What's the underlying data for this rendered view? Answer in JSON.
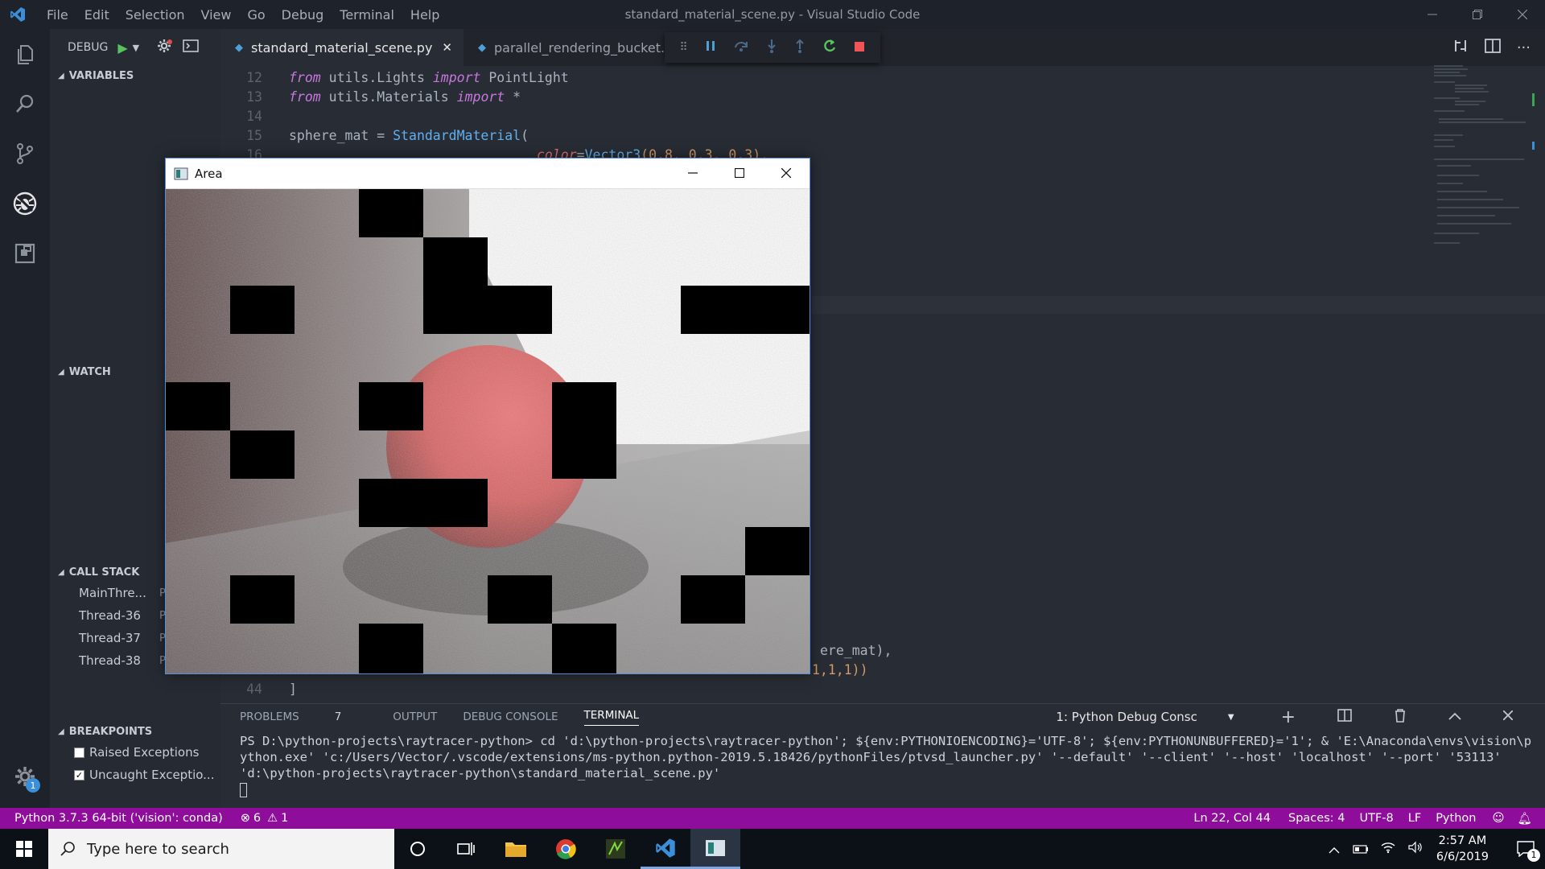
{
  "app": {
    "title": "standard_material_scene.py - Visual Studio Code"
  },
  "menu": [
    "File",
    "Edit",
    "Selection",
    "View",
    "Go",
    "Debug",
    "Terminal",
    "Help"
  ],
  "debug": {
    "label": "DEBUG"
  },
  "sections": {
    "variables": "VARIABLES",
    "watch": "WATCH",
    "call_stack": "CALL STACK",
    "breakpoints": "BREAKPOINTS"
  },
  "call_stack": [
    "MainThre...",
    "Thread-36",
    "Thread-37",
    "Thread-38"
  ],
  "call_stack_tag": "P",
  "breakpoints": [
    {
      "label": "Raised Exceptions",
      "checked": false
    },
    {
      "label": "Uncaught Exceptio...",
      "checked": true
    }
  ],
  "tabs": [
    {
      "label": "standard_material_scene.py",
      "active": true
    },
    {
      "label": "parallel_rendering_bucket.py",
      "active": false
    }
  ],
  "code_lines": {
    "l12": "12",
    "l13": "13",
    "l14": "14",
    "l15": "15",
    "l16": "16",
    "l44": "44"
  },
  "code": {
    "l12_a": "from",
    "l12_b": " utils.Lights ",
    "l12_c": "import",
    "l12_d": " PointLight",
    "l13_a": "from",
    "l13_b": " utils.Materials ",
    "l13_c": "import",
    "l13_d": " *",
    "l15_a": "sphere_mat = ",
    "l15_b": "StandardMaterial",
    "l15_c": "(",
    "l16_a": "color",
    "l16_b": "=",
    "l16_c": "Vector3",
    "l16_d": "(0.8, 0.3, 0.3),",
    "right1": "ere_mat),",
    "right2": "1,1,1))",
    "l44": "]"
  },
  "area_window": {
    "title": "Area"
  },
  "panel": {
    "tabs": [
      "PROBLEMS",
      "OUTPUT",
      "DEBUG CONSOLE",
      "TERMINAL"
    ],
    "problems_count": "7",
    "terminal_select": "1: Python Debug Consc",
    "terminal_text": "PS D:\\python-projects\\raytracer-python> cd 'd:\\python-projects\\raytracer-python'; ${env:PYTHONIOENCODING}='UTF-8'; ${env:PYTHONUNBUFFERED}='1'; & 'E:\\Anaconda\\envs\\vision\\python.exe' 'c:/Users/Vector/.vscode/extensions/ms-python.python-2019.5.18426/pythonFiles/ptvsd_launcher.py' '--default' '--client' '--host' 'localhost' '--port' '53113' 'd:\\python-projects\\raytracer-python\\standard_material_scene.py'"
  },
  "status": {
    "interpreter": "Python 3.7.3 64-bit ('vision': conda)",
    "errors": "6",
    "warnings": "1",
    "position": "Ln 22, Col 44",
    "spaces": "Spaces: 4",
    "encoding": "UTF-8",
    "eol": "LF",
    "language": "Python",
    "bell_count": ""
  },
  "activity_badge": "1",
  "taskbar": {
    "search_placeholder": "Type here to search",
    "time": "2:57 AM",
    "date": "6/6/2019",
    "notif_count": "1"
  },
  "colors": {
    "accent": "#8e0d9a",
    "editor_bg": "#282c34",
    "sidebar_bg": "#262b33"
  }
}
